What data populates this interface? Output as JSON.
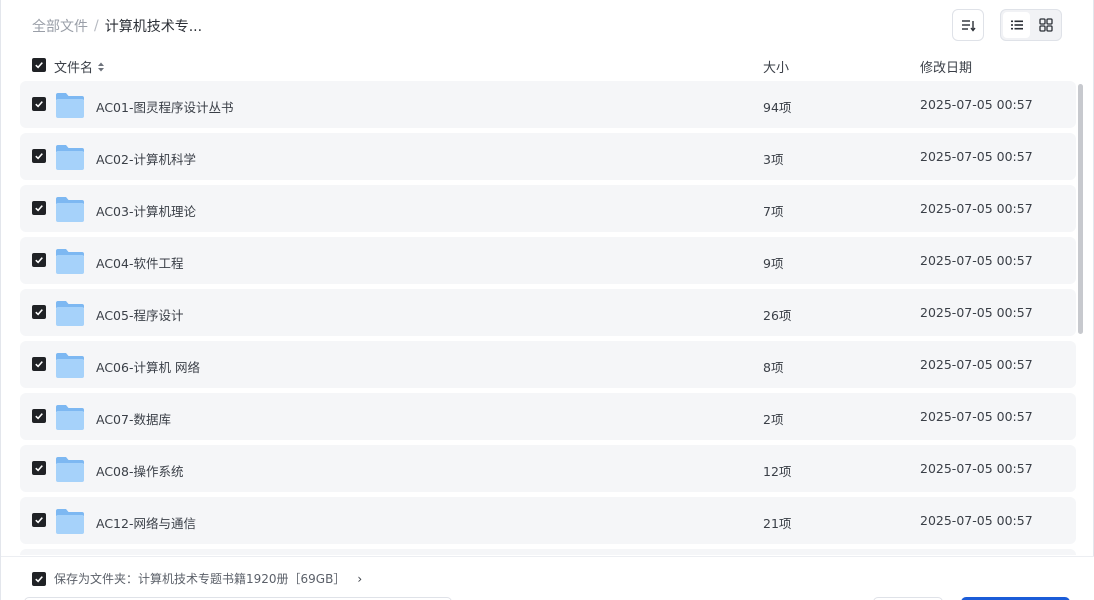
{
  "breadcrumb": {
    "root": "全部文件",
    "separator": "/",
    "current": "计算机技术专..."
  },
  "header": {
    "name": "文件名",
    "size": "大小",
    "date": "修改日期"
  },
  "files": [
    {
      "name": "AC01-图灵程序设计丛书",
      "size": "94项",
      "date": "2025-07-05 00:57"
    },
    {
      "name": "AC02-计算机科学",
      "size": "3项",
      "date": "2025-07-05 00:57"
    },
    {
      "name": "AC03-计算机理论",
      "size": "7项",
      "date": "2025-07-05 00:57"
    },
    {
      "name": "AC04-软件工程",
      "size": "9项",
      "date": "2025-07-05 00:57"
    },
    {
      "name": "AC05-程序设计",
      "size": "26项",
      "date": "2025-07-05 00:57"
    },
    {
      "name": "AC06-计算机 网络",
      "size": "8项",
      "date": "2025-07-05 00:57"
    },
    {
      "name": "AC07-数据库",
      "size": "2项",
      "date": "2025-07-05 00:57"
    },
    {
      "name": "AC08-操作系统",
      "size": "12项",
      "date": "2025-07-05 00:57"
    },
    {
      "name": "AC12-网络与通信",
      "size": "21项",
      "date": "2025-07-05 00:57"
    }
  ],
  "save": {
    "label": "保存为文件夹：计算机技术专题书籍1920册［69GB］",
    "arrow": "›"
  },
  "colors": {
    "checkbox": "#202226",
    "folder": "#8cc4f7",
    "row_bg": "#f5f6f8",
    "primary": "#1b5cd8"
  }
}
